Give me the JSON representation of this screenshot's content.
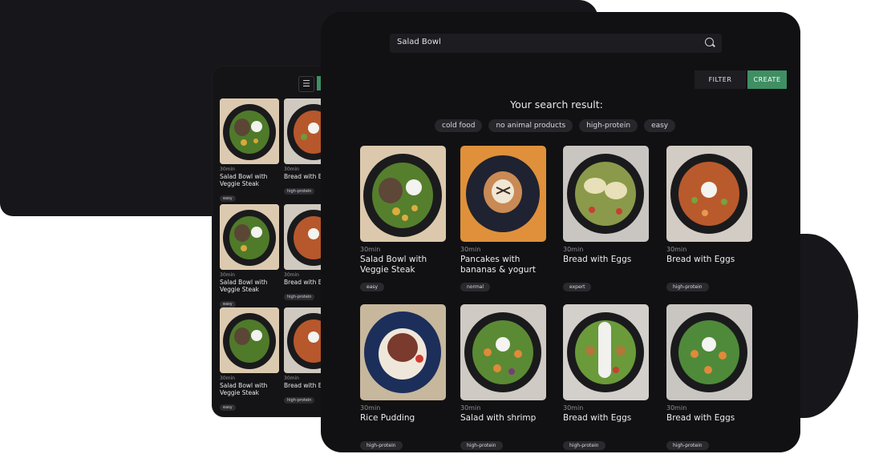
{
  "search": {
    "value": "Salad Bowl"
  },
  "toolbar": {
    "filter_label": "FILTER",
    "create_label": "CREATE"
  },
  "results_heading": "Your search result:",
  "filter_chips": [
    "cold food",
    "no animal products",
    "high-protein",
    "easy"
  ],
  "recipes": [
    {
      "time": "30min",
      "title": "Salad Bowl with Veggie Steak",
      "tag": "easy"
    },
    {
      "time": "30min",
      "title": "Pancakes with bananas & yogurt",
      "tag": "normal"
    },
    {
      "time": "30min",
      "title": "Bread with Eggs",
      "tag": "expert"
    },
    {
      "time": "30min",
      "title": "Bread with Eggs",
      "tag": "high-protein"
    },
    {
      "time": "30min",
      "title": "Rice Pudding",
      "tag": "high-protein"
    },
    {
      "time": "30min",
      "title": "Salad with shrimp",
      "tag": "high-protein"
    },
    {
      "time": "30min",
      "title": "Bread with Eggs",
      "tag": "high-protein"
    },
    {
      "time": "30min",
      "title": "Bread with Eggs",
      "tag": "high-protein"
    }
  ],
  "back_recipes": [
    {
      "time": "30min",
      "title": "Salad Bowl with Veggie Steak",
      "tag": "easy"
    },
    {
      "time": "30min",
      "title": "Bread with Eggs",
      "tag": "high-protein"
    },
    {
      "time": "30min",
      "title": "Salad Bowl with Veggie Steak",
      "tag": "easy"
    },
    {
      "time": "30min",
      "title": "Bread with Eggs",
      "tag": "high-protein"
    },
    {
      "time": "30min",
      "title": "Salad Bowl with Veggie Steak",
      "tag": "easy"
    },
    {
      "time": "30min",
      "title": "Bread with Eggs",
      "tag": "high-protein"
    }
  ],
  "colors": {
    "accent": "#3f8f63",
    "background": "#111113",
    "chip": "#26262b"
  },
  "icons": {
    "search": "search-icon",
    "filter": "sliders-icon"
  }
}
